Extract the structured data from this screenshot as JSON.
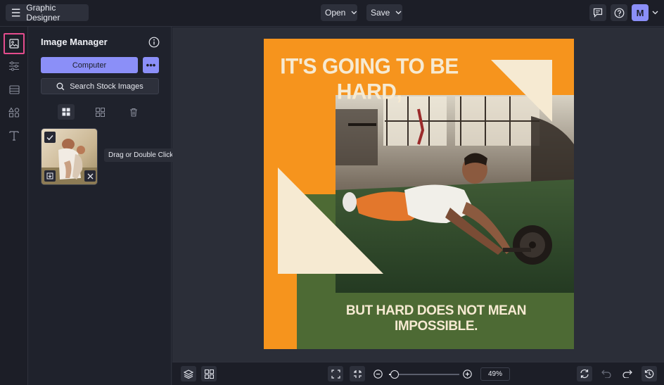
{
  "header": {
    "app_title": "Graphic Designer",
    "open_label": "Open",
    "save_label": "Save",
    "avatar_initial": "M"
  },
  "sidebar_rail": {
    "items": [
      {
        "name": "image-icon",
        "active": true
      },
      {
        "name": "adjustments-icon",
        "active": false
      },
      {
        "name": "layout-icon",
        "active": false
      },
      {
        "name": "shapes-icon",
        "active": false
      },
      {
        "name": "text-icon",
        "active": false
      }
    ]
  },
  "panel": {
    "title": "Image Manager",
    "computer_label": "Computer",
    "more_label": "•••",
    "stock_label": "Search Stock Images",
    "tooltip": "Drag or Double Click"
  },
  "canvas": {
    "headline": "IT'S GOING TO BE HARD,",
    "subline": "BUT HARD DOES NOT MEAN IMPOSSIBLE.",
    "colors": {
      "orange": "#f6941d",
      "green": "#4d6a34",
      "cream": "#f6ead2"
    }
  },
  "footer": {
    "zoom": "49%",
    "zoom_level": 0.08
  },
  "colors": {
    "accent": "#8b8ff8",
    "active_border": "#e54c8d"
  }
}
